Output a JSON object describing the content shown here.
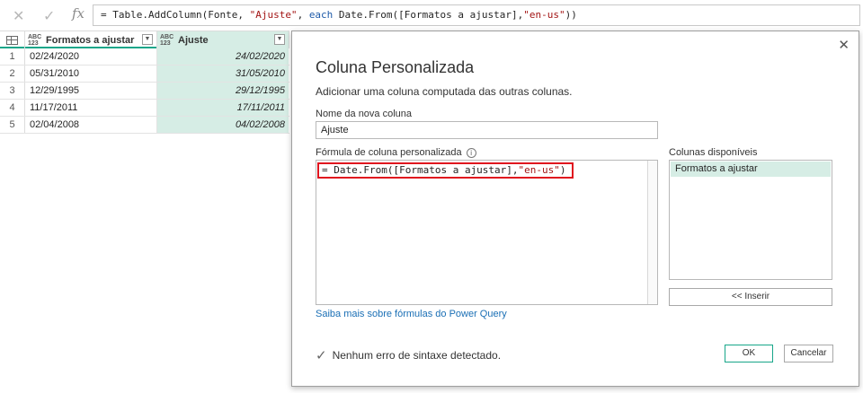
{
  "formula_bar": {
    "cancel_glyph": "✕",
    "confirm_glyph": "✓",
    "fx_label": "fx",
    "formula_prefix": "= Table.AddColumn(Fonte, ",
    "formula_str1": "\"Ajuste\"",
    "formula_sep": ", ",
    "formula_kw": "each",
    "formula_rest": " Date.From([Formatos a ajustar],",
    "formula_str2": "\"en-us\"",
    "formula_end": "))"
  },
  "grid": {
    "columns": [
      {
        "type_top": "ABC",
        "type_bottom": "123",
        "name": "Formatos a ajustar"
      },
      {
        "type_top": "ABC",
        "type_bottom": "123",
        "name": "Ajuste"
      }
    ],
    "rows": [
      {
        "n": "1",
        "orig": "02/24/2020",
        "adj": "24/02/2020"
      },
      {
        "n": "2",
        "orig": "05/31/2010",
        "adj": "31/05/2010"
      },
      {
        "n": "3",
        "orig": "12/29/1995",
        "adj": "29/12/1995"
      },
      {
        "n": "4",
        "orig": "11/17/2011",
        "adj": "17/11/2011"
      },
      {
        "n": "5",
        "orig": "02/04/2008",
        "adj": "04/02/2008"
      }
    ]
  },
  "dialog": {
    "title": "Coluna Personalizada",
    "subtitle": "Adicionar uma coluna computada das outras colunas.",
    "name_label": "Nome da nova coluna",
    "name_value": "Ajuste",
    "formula_label": "Fórmula de coluna personalizada",
    "info_glyph": "i",
    "code_prefix": "= Date.From([Formatos a ajustar],",
    "code_str": "\"en-us\"",
    "code_end": ")",
    "available_label": "Colunas disponíveis",
    "available_columns": [
      "Formatos a ajustar"
    ],
    "insert_label": "<< Inserir",
    "learn_link": "Saiba mais sobre fórmulas do Power Query",
    "status_text": "Nenhum erro de sintaxe detectado.",
    "ok_label": "OK",
    "cancel_label": "Cancelar",
    "close_glyph": "✕"
  },
  "colors": {
    "accent": "#17a689",
    "highlight": "#d6ede5",
    "error_box": "#e0141e",
    "link": "#1a6fb5"
  }
}
